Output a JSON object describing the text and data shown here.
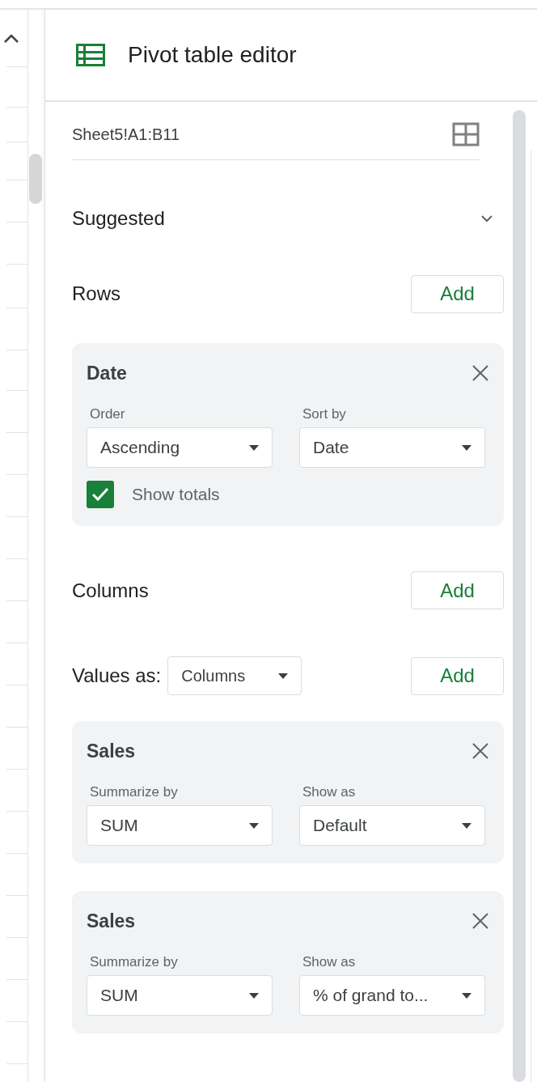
{
  "header": {
    "title": "Pivot table editor"
  },
  "range": {
    "value": "Sheet5!A1:B11"
  },
  "suggested": {
    "label": "Suggested",
    "expanded": false
  },
  "rows": {
    "label": "Rows",
    "add": "Add",
    "fields": [
      {
        "name": "Date",
        "controls": [
          {
            "label": "Order",
            "value": "Ascending"
          },
          {
            "label": "Sort by",
            "value": "Date"
          }
        ],
        "show_totals": {
          "label": "Show totals",
          "checked": true
        }
      }
    ]
  },
  "columns": {
    "label": "Columns",
    "add": "Add"
  },
  "values": {
    "label": "Values as:",
    "layout": "Columns",
    "add": "Add",
    "fields": [
      {
        "name": "Sales",
        "controls": [
          {
            "label": "Summarize by",
            "value": "SUM"
          },
          {
            "label": "Show as",
            "value": "Default"
          }
        ]
      },
      {
        "name": "Sales",
        "controls": [
          {
            "label": "Summarize by",
            "value": "SUM"
          },
          {
            "label": "Show as",
            "value": "% of grand to..."
          }
        ]
      }
    ]
  }
}
